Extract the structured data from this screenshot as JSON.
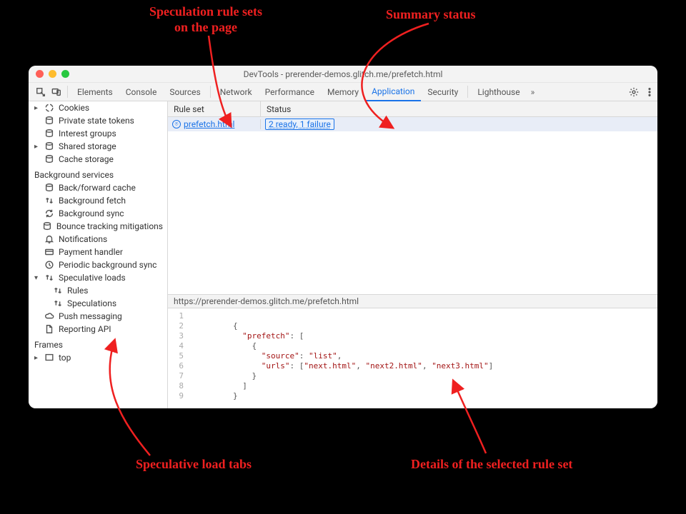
{
  "annotations": {
    "top_left": "Speculation rule sets\non the page",
    "top_right": "Summary status",
    "bottom_left": "Speculative load tabs",
    "bottom_right": "Details of the selected rule set"
  },
  "window": {
    "title": "DevTools - prerender-demos.glitch.me/prefetch.html"
  },
  "tabs": {
    "items": [
      "Elements",
      "Console",
      "Sources",
      "Network",
      "Performance",
      "Memory",
      "Application",
      "Security",
      "Lighthouse"
    ],
    "active": "Application",
    "overflow": "»"
  },
  "sidebar": {
    "group1": {
      "cookies": "Cookies",
      "private_state": "Private state tokens",
      "interest_groups": "Interest groups",
      "shared_storage": "Shared storage",
      "cache_storage": "Cache storage"
    },
    "header2": "Background services",
    "group2": {
      "bfcache": "Back/forward cache",
      "bg_fetch": "Background fetch",
      "bg_sync": "Background sync",
      "bounce": "Bounce tracking mitigations",
      "notifications": "Notifications",
      "pay": "Payment handler",
      "periodic": "Periodic background sync",
      "speculative": "Speculative loads",
      "rules": "Rules",
      "speculations": "Speculations",
      "push": "Push messaging",
      "reporting": "Reporting API"
    },
    "header3": "Frames",
    "group3": {
      "top": "top"
    }
  },
  "table": {
    "col_rs": "Rule set",
    "col_st": "Status",
    "row0": {
      "rs_label": " prefetch.html",
      "status": "2 ready, 1 failure"
    }
  },
  "urlbar": "https://prerender-demos.glitch.me/prefetch.html",
  "code": {
    "lines": [
      "1",
      "2",
      "3",
      "4",
      "5",
      "6",
      "7",
      "8",
      "9"
    ],
    "text": {
      "l2": "{",
      "l3a": "  \"prefetch\"",
      "l3b": ": [",
      "l4": "    {",
      "l5a": "      \"source\"",
      "l5b": ": ",
      "l5c": "\"list\"",
      "l5d": ",",
      "l6a": "      \"urls\"",
      "l6b": ": [",
      "l6c": "\"next.html\"",
      "l6d": ", ",
      "l6e": "\"next2.html\"",
      "l6f": ", ",
      "l6g": "\"next3.html\"",
      "l6h": "]",
      "l7": "    }",
      "l8": "  ]",
      "l9": "}"
    }
  }
}
